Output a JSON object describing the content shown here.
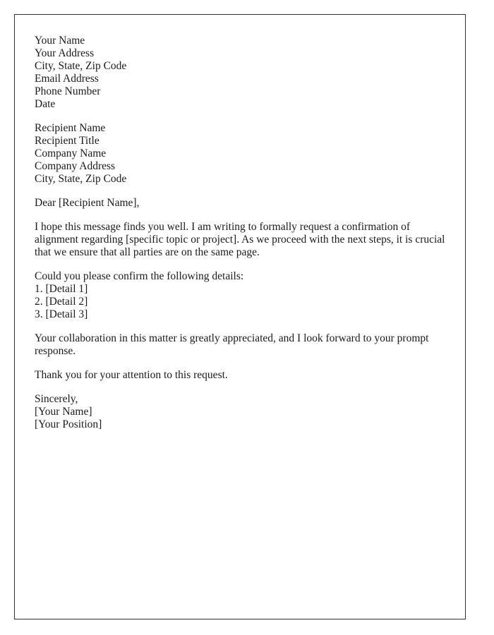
{
  "letter": {
    "sender": {
      "name": "Your Name",
      "address": "Your Address",
      "city_state_zip": "City, State, Zip Code",
      "email": "Email Address",
      "phone": "Phone Number",
      "date": "Date"
    },
    "recipient": {
      "name": "Recipient Name",
      "title": "Recipient Title",
      "company": "Company Name",
      "company_address": "Company Address",
      "city_state_zip": "City, State, Zip Code"
    },
    "salutation": "Dear [Recipient Name],",
    "paragraph_1": "I hope this message finds you well. I am writing to formally request a confirmation of alignment regarding [specific topic or project]. As we proceed with the next steps, it is crucial that we ensure that all parties are on the same page.",
    "details_intro": "Could you please confirm the following details:",
    "details": [
      "1. [Detail 1]",
      "2. [Detail 2]",
      "3. [Detail 3]"
    ],
    "paragraph_2": "Your collaboration in this matter is greatly appreciated, and I look forward to your prompt response.",
    "paragraph_3": "Thank you for your attention to this request.",
    "closing": "Sincerely,",
    "signature_name": "[Your Name]",
    "signature_position": "[Your Position]"
  }
}
